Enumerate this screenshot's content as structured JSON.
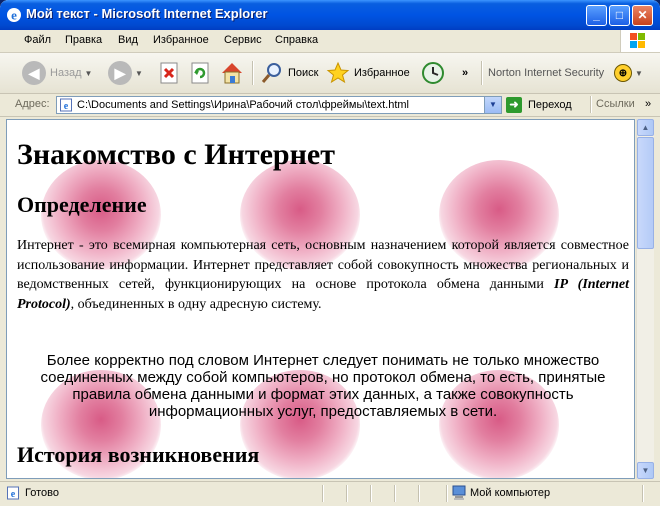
{
  "window": {
    "title": "Мой текст - Microsoft Internet Explorer"
  },
  "menu": {
    "items": [
      "Файл",
      "Правка",
      "Вид",
      "Избранное",
      "Сервис",
      "Справка"
    ]
  },
  "toolbar": {
    "back_label": "Назад",
    "search_label": "Поиск",
    "favorites_label": "Избранное",
    "more_label": "»",
    "norton_label": "Norton Internet Security"
  },
  "address": {
    "label": "Адрес:",
    "value": "C:\\Documents and Settings\\Ирина\\Рабочий стол\\фреймы\\text.html",
    "go_label": "Переход",
    "links_label": "Ссылки",
    "links_more": "»"
  },
  "page": {
    "heading": "Знакомство с Интернет",
    "section1_heading": "Определение",
    "para1_text1": "Интернет - это всемирная компьютерная сеть, основным назначением которой является совместное использование информации. Интернет представляет собой совокупность множества региональных и ведомственных сетей, функционирующих на основе протокола обмена данными ",
    "para1_emphasis": "IP (Internet Protocol)",
    "para1_text2": ", объединенных в одну адресную систему.",
    "para2": "Более корректно под словом Интернет следует понимать не только множество соединенных между собой компьютеров, но протокол обмена, то есть, принятые правила обмена данными и формат этих данных, а также совокупность информационных услуг, предоставляемых в сети.",
    "section2_heading": "История возникновения"
  },
  "status": {
    "text": "Готово",
    "zone": "Мой компьютер"
  }
}
